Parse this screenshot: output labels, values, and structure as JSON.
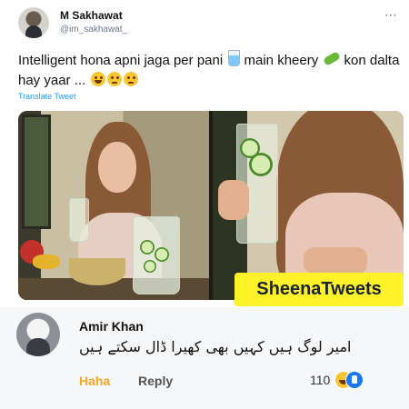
{
  "tweet": {
    "author_name": "M Sakhawat",
    "author_handle": "@im_sakhawat_",
    "text_part1": "Intelligent hona apni jaga per pani ",
    "text_part2": " main kheery ",
    "text_part3": " kon dalta hay yaar ... ",
    "translate_label": "Translate Tweet",
    "more_icon": "⋯",
    "emoji_icons": [
      "tumbler-glass-icon",
      "cucumber-icon",
      "laughing-face-icon",
      "flushed-face-icon",
      "flushed-face-icon"
    ]
  },
  "media": {
    "watermark": "SheenaTweets"
  },
  "reply": {
    "name": "Amir Khan",
    "text": "امیر لوگ ہیں کہیں بھی کھیرا ڈال سکتے ہیں",
    "haha_label": "Haha",
    "reply_label": "Reply",
    "reaction_count": "110",
    "reaction_icons": [
      "haha-reaction-icon",
      "like-reaction-icon"
    ]
  },
  "colors": {
    "link_blue": "#1d9bf0",
    "watermark_yellow": "#fdf227",
    "haha_orange": "#f5a623",
    "like_blue": "#1877f2"
  }
}
